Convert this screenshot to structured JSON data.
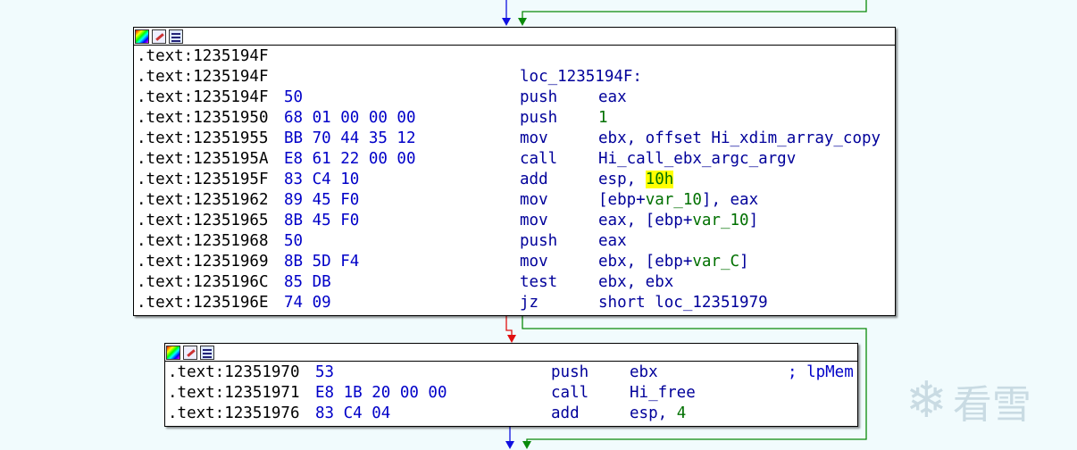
{
  "node1": {
    "lines": [
      {
        "addr": ".text:1235194F",
        "bytes": "",
        "mnemonic": "",
        "operands": [],
        "label": ""
      },
      {
        "addr": ".text:1235194F",
        "bytes": "",
        "mnemonic": "",
        "operands": [],
        "label": "loc_1235194F:"
      },
      {
        "addr": ".text:1235194F",
        "bytes": "50",
        "mnemonic": "push",
        "operands": [
          {
            "t": "eax",
            "c": "op"
          }
        ],
        "label": ""
      },
      {
        "addr": ".text:12351950",
        "bytes": "68 01 00 00 00",
        "mnemonic": "push",
        "operands": [
          {
            "t": "1",
            "c": "num"
          }
        ],
        "label": ""
      },
      {
        "addr": ".text:12351955",
        "bytes": "BB 70 44 35 12",
        "mnemonic": "mov",
        "operands": [
          {
            "t": "ebx, offset Hi_xdim_array_copy",
            "c": "op"
          }
        ],
        "label": ""
      },
      {
        "addr": ".text:1235195A",
        "bytes": "E8 61 22 00 00",
        "mnemonic": "call",
        "operands": [
          {
            "t": "Hi_call_ebx_argc_argv",
            "c": "op"
          }
        ],
        "label": ""
      },
      {
        "addr": ".text:1235195F",
        "bytes": "83 C4 10",
        "mnemonic": "add",
        "operands": [
          {
            "t": "esp, ",
            "c": "op"
          },
          {
            "t": "10h",
            "c": "hl"
          }
        ],
        "label": ""
      },
      {
        "addr": ".text:12351962",
        "bytes": "89 45 F0",
        "mnemonic": "mov",
        "operands": [
          {
            "t": "[ebp+",
            "c": "op"
          },
          {
            "t": "var_10",
            "c": "var"
          },
          {
            "t": "], eax",
            "c": "op"
          }
        ],
        "label": ""
      },
      {
        "addr": ".text:12351965",
        "bytes": "8B 45 F0",
        "mnemonic": "mov",
        "operands": [
          {
            "t": "eax, [ebp+",
            "c": "op"
          },
          {
            "t": "var_10",
            "c": "var"
          },
          {
            "t": "]",
            "c": "op"
          }
        ],
        "label": ""
      },
      {
        "addr": ".text:12351968",
        "bytes": "50",
        "mnemonic": "push",
        "operands": [
          {
            "t": "eax",
            "c": "op"
          }
        ],
        "label": ""
      },
      {
        "addr": ".text:12351969",
        "bytes": "8B 5D F4",
        "mnemonic": "mov",
        "operands": [
          {
            "t": "ebx, [ebp+",
            "c": "op"
          },
          {
            "t": "var_C",
            "c": "var"
          },
          {
            "t": "]",
            "c": "op"
          }
        ],
        "label": ""
      },
      {
        "addr": ".text:1235196C",
        "bytes": "85 DB",
        "mnemonic": "test",
        "operands": [
          {
            "t": "ebx, ebx",
            "c": "op"
          }
        ],
        "label": ""
      },
      {
        "addr": ".text:1235196E",
        "bytes": "74 09",
        "mnemonic": "jz",
        "operands": [
          {
            "t": "short loc_12351979",
            "c": "op"
          }
        ],
        "label": ""
      }
    ]
  },
  "node2": {
    "lines": [
      {
        "addr": ".text:12351970",
        "bytes": "53",
        "mnemonic": "push",
        "operands": [
          {
            "t": "ebx",
            "c": "op"
          }
        ],
        "comment": "; lpMem"
      },
      {
        "addr": ".text:12351971",
        "bytes": "E8 1B 20 00 00",
        "mnemonic": "call",
        "operands": [
          {
            "t": "Hi_free",
            "c": "op"
          }
        ],
        "comment": ""
      },
      {
        "addr": ".text:12351976",
        "bytes": "83 C4 04",
        "mnemonic": "add",
        "operands": [
          {
            "t": "esp, ",
            "c": "op"
          },
          {
            "t": "4",
            "c": "num"
          }
        ],
        "comment": ""
      }
    ]
  },
  "header_icons": [
    "color-palette-icon",
    "edit-node-icon",
    "graph-overview-icon"
  ],
  "watermark": {
    "glyph": "❄",
    "text": "看雪"
  },
  "colors": {
    "true_edge": "#0a8a0a",
    "false_edge": "#e01010",
    "flow_edge": "#1010e0",
    "highlight": "#ffff00"
  }
}
